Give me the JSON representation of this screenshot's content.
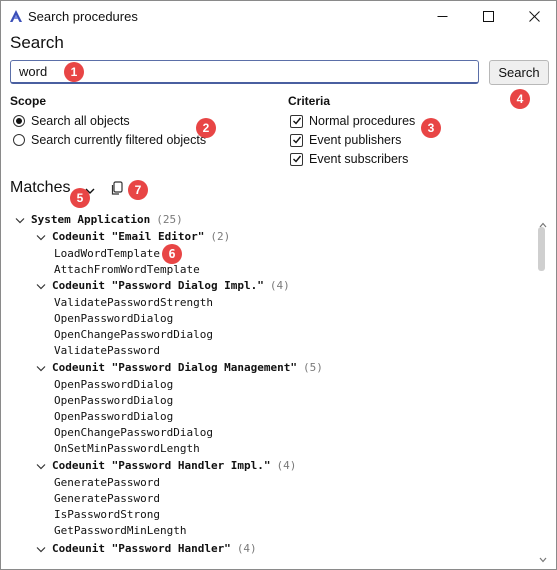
{
  "window": {
    "title": "Search procedures"
  },
  "heading": "Search",
  "search": {
    "value": "word",
    "button_label": "Search"
  },
  "scope": {
    "label": "Scope",
    "options": [
      {
        "label": "Search all objects",
        "selected": true
      },
      {
        "label": "Search currently filtered objects",
        "selected": false
      }
    ]
  },
  "criteria": {
    "label": "Criteria",
    "options": [
      {
        "label": "Normal procedures",
        "checked": true
      },
      {
        "label": "Event publishers",
        "checked": true
      },
      {
        "label": "Event subscribers",
        "checked": true
      }
    ]
  },
  "matches": {
    "label": "Matches"
  },
  "badges": [
    "1",
    "2",
    "3",
    "4",
    "5",
    "6",
    "7"
  ],
  "tree": {
    "root": {
      "label": "System Application",
      "count": "(25)"
    },
    "groups": [
      {
        "label": "Codeunit \"Email Editor\"",
        "count": "(2)",
        "items": [
          "LoadWordTemplate",
          "AttachFromWordTemplate"
        ]
      },
      {
        "label": "Codeunit \"Password Dialog Impl.\"",
        "count": "(4)",
        "items": [
          "ValidatePasswordStrength",
          "OpenPasswordDialog",
          "OpenChangePasswordDialog",
          "ValidatePassword"
        ]
      },
      {
        "label": "Codeunit \"Password Dialog Management\"",
        "count": "(5)",
        "items": [
          "OpenPasswordDialog",
          "OpenPasswordDialog",
          "OpenPasswordDialog",
          "OpenChangePasswordDialog",
          "OnSetMinPasswordLength"
        ]
      },
      {
        "label": "Codeunit \"Password Handler Impl.\"",
        "count": "(4)",
        "items": [
          "GeneratePassword",
          "GeneratePassword",
          "IsPasswordStrong",
          "GetPasswordMinLength"
        ]
      },
      {
        "label": "Codeunit \"Password Handler\"",
        "count": "(4)",
        "items": []
      }
    ]
  },
  "colors": {
    "badge": "#e84545",
    "accent": "#4a5fa0"
  }
}
